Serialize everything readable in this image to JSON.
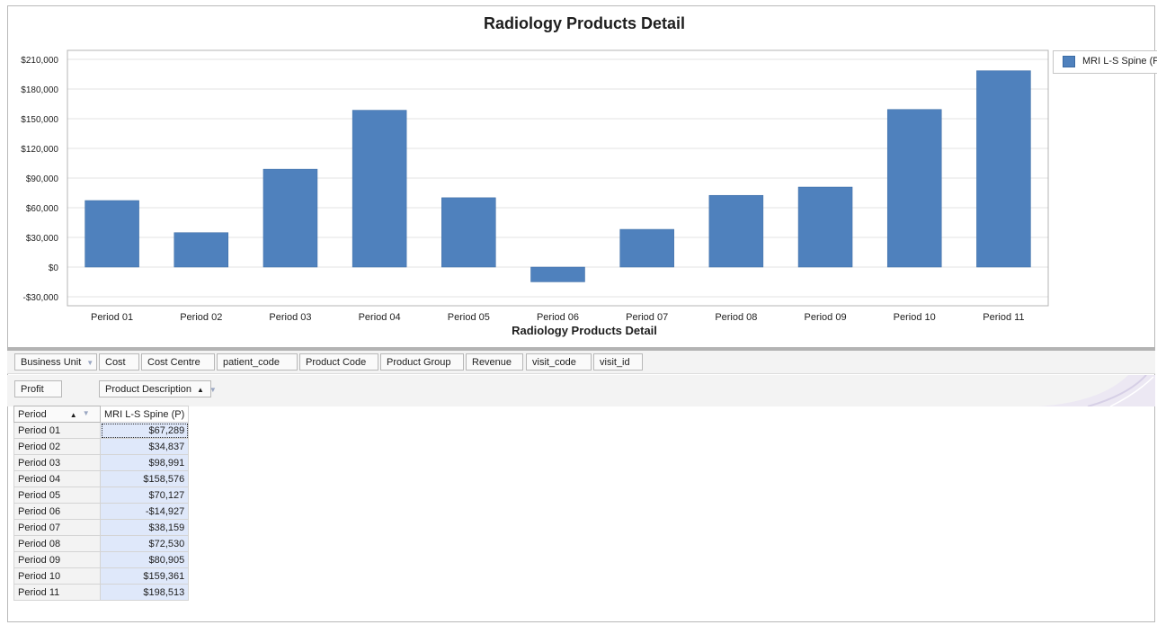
{
  "chart": {
    "title": "Radiology Products Detail",
    "x_axis_title": "Radiology Products Detail",
    "legend_label": "MRI L-S Spine (P)"
  },
  "chart_data": {
    "type": "bar",
    "title": "Radiology Products Detail",
    "xlabel": "Radiology Products Detail",
    "ylabel": "",
    "categories": [
      "Period 01",
      "Period 02",
      "Period 03",
      "Period 04",
      "Period 05",
      "Period 06",
      "Period 07",
      "Period 08",
      "Period 09",
      "Period 10",
      "Period 11"
    ],
    "series": [
      {
        "name": "MRI L-S Spine (P)",
        "values": [
          67289,
          34837,
          98991,
          158576,
          70127,
          -14927,
          38159,
          72530,
          80905,
          159361,
          198513
        ]
      }
    ],
    "ylim": [
      -30000,
      210000
    ],
    "yticks": [
      -30000,
      0,
      30000,
      60000,
      90000,
      120000,
      150000,
      180000,
      210000
    ],
    "ytick_labels": [
      "-$30,000",
      "$0",
      "$30,000",
      "$60,000",
      "$90,000",
      "$120,000",
      "$150,000",
      "$180,000",
      "$210,000"
    ],
    "grid": true,
    "legend_position": "right",
    "bar_color": "#4f81bd"
  },
  "filter_fields": [
    {
      "label": "Business Unit",
      "filter": true
    },
    {
      "label": "Cost",
      "filter": false
    },
    {
      "label": "Cost Centre",
      "filter": false
    },
    {
      "label": "patient_code",
      "filter": false
    },
    {
      "label": "Product Code",
      "filter": false
    },
    {
      "label": "Product Group",
      "filter": false
    },
    {
      "label": "Revenue",
      "filter": false
    },
    {
      "label": "visit_code",
      "filter": false
    },
    {
      "label": "visit_id",
      "filter": false
    }
  ],
  "data_field": "Profit",
  "column_field": "Product Description",
  "row_field": "Period",
  "column_header": "MRI L-S Spine (P)",
  "rows": [
    {
      "period": "Period 01",
      "value": "$67,289"
    },
    {
      "period": "Period 02",
      "value": "$34,837"
    },
    {
      "period": "Period 03",
      "value": "$98,991"
    },
    {
      "period": "Period 04",
      "value": "$158,576"
    },
    {
      "period": "Period 05",
      "value": "$70,127"
    },
    {
      "period": "Period 06",
      "value": "-$14,927"
    },
    {
      "period": "Period 07",
      "value": "$38,159"
    },
    {
      "period": "Period 08",
      "value": "$72,530"
    },
    {
      "period": "Period 09",
      "value": "$80,905"
    },
    {
      "period": "Period 10",
      "value": "$159,361"
    },
    {
      "period": "Period 11",
      "value": "$198,513"
    }
  ]
}
